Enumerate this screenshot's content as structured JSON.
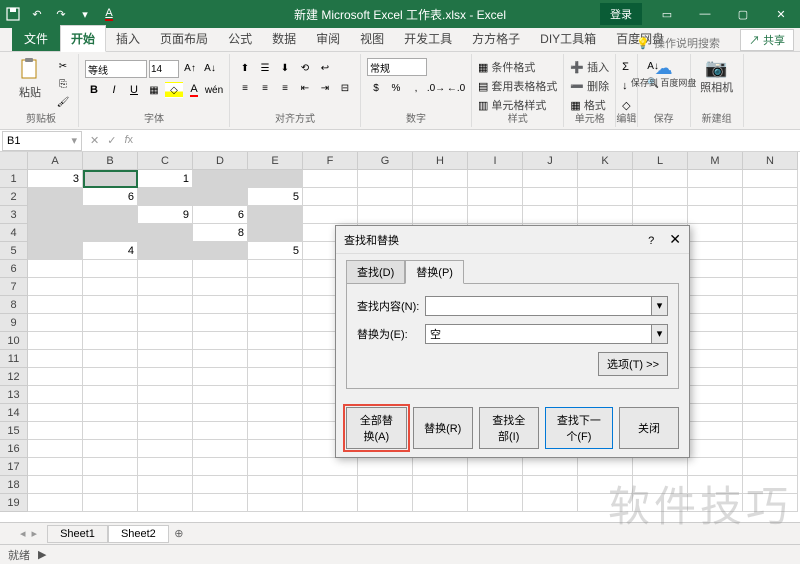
{
  "title": "新建 Microsoft Excel 工作表.xlsx  -  Excel",
  "login": "登录",
  "tabs": [
    "文件",
    "开始",
    "插入",
    "页面布局",
    "公式",
    "数据",
    "审阅",
    "视图",
    "开发工具",
    "方方格子",
    "DIY工具箱",
    "百度网盘"
  ],
  "active_tab": 1,
  "search_help": "操作说明搜索",
  "share": "共享",
  "ribbon": {
    "clipboard": {
      "paste": "粘贴",
      "label": "剪贴板"
    },
    "font": {
      "name": "等线",
      "size": "14",
      "label": "字体"
    },
    "align": {
      "label": "对齐方式"
    },
    "number": {
      "fmt": "常规",
      "label": "数字"
    },
    "styles": {
      "cond": "条件格式",
      "table": "套用表格格式",
      "cell": "单元格样式",
      "label": "样式"
    },
    "cells": {
      "insert": "插入",
      "delete": "删除",
      "format": "格式",
      "label": "单元格"
    },
    "editing": {
      "label": "编辑"
    },
    "save": {
      "save": "保存到\n百度网盘",
      "label": "保存"
    },
    "camera": {
      "camera": "照相机",
      "label": "新建组"
    }
  },
  "name_box": "B1",
  "columns": [
    "A",
    "B",
    "C",
    "D",
    "E",
    "F",
    "G",
    "H",
    "I",
    "J",
    "K",
    "L",
    "M",
    "N"
  ],
  "rows": 19,
  "cell_data": {
    "A1": "3",
    "C1": "1",
    "B2": "6",
    "E2": "5",
    "C3": "9",
    "D3": "6",
    "D4": "8",
    "B5": "4",
    "E5": "5"
  },
  "selected_cells": [
    "A1",
    "B1",
    "C1",
    "D1",
    "E1",
    "A2",
    "B2",
    "C2",
    "D2",
    "E2",
    "A3",
    "B3",
    "C3",
    "D3",
    "E3",
    "A4",
    "B4",
    "C4",
    "D4",
    "E4",
    "A5",
    "B5",
    "C5",
    "D5",
    "E5"
  ],
  "active_cell": "B1",
  "sheets": [
    "Sheet1",
    "Sheet2"
  ],
  "active_sheet": 1,
  "status": "就绪",
  "dialog": {
    "title": "查找和替换",
    "tabs": [
      "查找(D)",
      "替换(P)"
    ],
    "active_tab": 1,
    "find_label": "查找内容(N):",
    "find_value": "",
    "replace_label": "替换为(E):",
    "replace_value": "空",
    "options": "选项(T) >>",
    "buttons": [
      "全部替换(A)",
      "替换(R)",
      "查找全部(I)",
      "查找下一个(F)",
      "关闭"
    ]
  },
  "watermark": "软件技巧"
}
